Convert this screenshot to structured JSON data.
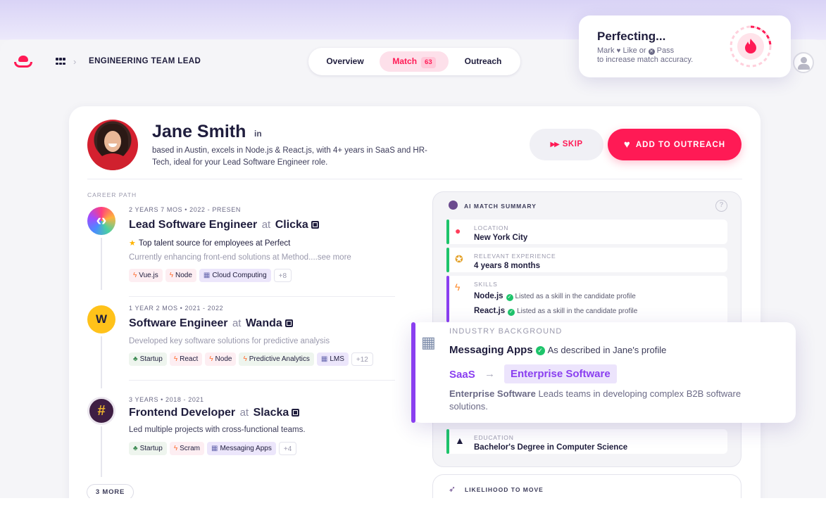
{
  "header": {
    "role_title": "ENGINEERING TEAM LEAD",
    "tabs": [
      {
        "label": "Overview"
      },
      {
        "label": "Match",
        "count": "63"
      },
      {
        "label": "Outreach"
      }
    ]
  },
  "perfecting": {
    "title": "Perfecting...",
    "line1_a": "Mark",
    "line1_b": "Like or",
    "line1_c": "Pass",
    "line2": "to increase match accuracy.",
    "icon": "flame-icon"
  },
  "candidate": {
    "name": "Jane Smith",
    "linkedin": "in",
    "bio": "based in Austin, excels in Node.js & React.js, with 4+ years in SaaS and HR-Tech, ideal for your Lead Software Engineer role.",
    "skip_label": "SKIP",
    "add_label": "ADD TO OUTREACH"
  },
  "career": {
    "label": "CAREER PATH",
    "jobs": [
      {
        "meta": "2 YEARS 7 MOS • 2022 - PRESEN",
        "title": "Lead Software Engineer",
        "at": "at",
        "company": "Clicka",
        "highlight": "Top talent source for employees at Perfect",
        "desc": "Currently enhancing front-end solutions at Method....",
        "see_more": "see more",
        "tags": [
          "Vue.js",
          "Node",
          "Cloud Computing",
          "+8"
        ]
      },
      {
        "meta": "1 YEAR 2 MOS • 2021 - 2022",
        "title": "Software Engineer",
        "at": "at",
        "company": "Wanda",
        "desc": "Developed key software solutions for predictive analysis",
        "tags": [
          "Startup",
          "React",
          "Node",
          "Predictive Analytics",
          "LMS",
          "+12"
        ]
      },
      {
        "meta": "3 YEARS • 2018 - 2021",
        "title": "Frontend Developer",
        "at": "at",
        "company": "Slacka",
        "desc": "Led multiple projects with cross-functional teams.",
        "tags": [
          "Startup",
          "Scram",
          "Messaging Apps",
          "+4"
        ]
      }
    ],
    "more_label": "3 MORE"
  },
  "summary": {
    "title": "AI MATCH SUMMARY",
    "help": "?",
    "location": {
      "label": "LOCATION",
      "value": "New York City"
    },
    "experience": {
      "label": "RELEVANT EXPERIENCE",
      "value": "4 years 8 months"
    },
    "skills": {
      "label": "SKILLS",
      "items": [
        {
          "name": "Node.js",
          "note": "Listed as a skill in the candidate profile"
        },
        {
          "name": "React.js",
          "note": "Listed as a skill in the candidate profile"
        }
      ]
    },
    "education": {
      "label": "EDUCATION",
      "value": "Bachelor's Degree in Computer Science"
    }
  },
  "industry": {
    "label": "INDUSTRY BACKGROUND",
    "value": "Messaging Apps",
    "value_note": "As described in Jane's profile",
    "from": "SaaS",
    "arrow": "→",
    "to": "Enterprise Software",
    "expl_bold": "Enterprise Software",
    "expl_rest": " Leads teams in developing complex B2B software solutions."
  },
  "likelihood": {
    "label": "LIKELIHOOD TO MOVE"
  },
  "colors": {
    "accent": "#ff1a55",
    "violet": "#8a3ff0",
    "green": "#1ec46b"
  }
}
